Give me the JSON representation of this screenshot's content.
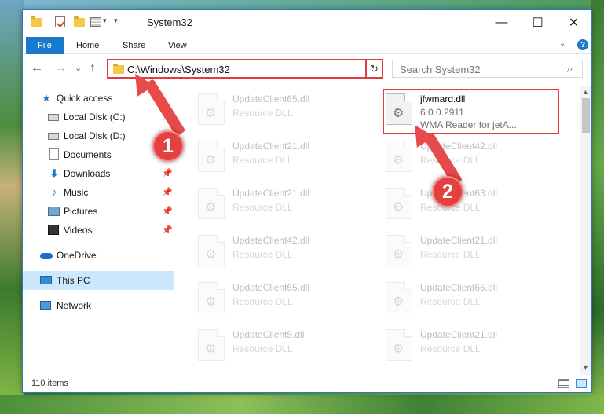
{
  "window": {
    "title": "System32",
    "controls": {
      "minimize": "—",
      "maximize": "☐",
      "close": "✕"
    }
  },
  "ribbon": {
    "tabs": [
      "File",
      "Home",
      "Share",
      "View"
    ],
    "help": "?"
  },
  "navigation": {
    "back": "←",
    "forward": "→",
    "recent": "⌄",
    "up": "↑",
    "address": "C:\\Windows\\System32",
    "search_placeholder": "Search System32"
  },
  "sidebar": {
    "items": [
      {
        "label": "Quick access",
        "icon": "star-icon"
      },
      {
        "label": "Local Disk (C:)",
        "icon": "drive-icon",
        "pinned": true
      },
      {
        "label": "Local Disk (D:)",
        "icon": "drive-icon"
      },
      {
        "label": "Documents",
        "icon": "documents-icon",
        "pinned": true
      },
      {
        "label": "Downloads",
        "icon": "downloads-icon",
        "pinned": true
      },
      {
        "label": "Music",
        "icon": "music-icon",
        "pinned": true
      },
      {
        "label": "Pictures",
        "icon": "pictures-icon",
        "pinned": true
      },
      {
        "label": "Videos",
        "icon": "videos-icon",
        "pinned": true
      },
      {
        "label": "OneDrive",
        "icon": "onedrive-icon"
      },
      {
        "label": "This PC",
        "icon": "this-pc-icon",
        "selected": true
      },
      {
        "label": "Network",
        "icon": "network-icon"
      }
    ]
  },
  "files": [
    {
      "name": "UpdateClient65.dll",
      "line1": "Resource DLL",
      "line2": ""
    },
    {
      "name": "jfwmard.dll",
      "line1": "6.0.0.2911",
      "line2": "WMA Reader for jetA..."
    },
    {
      "name": "UpdateClient21.dll",
      "line1": "Resource DLL",
      "line2": ""
    },
    {
      "name": "UpdateClient42.dll",
      "line1": "Resource DLL",
      "line2": ""
    },
    {
      "name": "UpdateClient21.dll",
      "line1": "Resource DLL",
      "line2": ""
    },
    {
      "name": "UpdateClient63.dll",
      "line1": "Resource DLL",
      "line2": ""
    },
    {
      "name": "UpdateClient42.dll",
      "line1": "Resource DLL",
      "line2": ""
    },
    {
      "name": "UpdateClient21.dll",
      "line1": "Resource DLL",
      "line2": ""
    },
    {
      "name": "UpdateClient65.dll",
      "line1": "Resource DLL",
      "line2": ""
    },
    {
      "name": "UpdateClient65.dll",
      "line1": "Resource DLL",
      "line2": ""
    },
    {
      "name": "UpdateClient5.dll",
      "line1": "Resource DLL",
      "line2": ""
    },
    {
      "name": "UpdateClient21.dll",
      "line1": "Resource DLL",
      "line2": ""
    }
  ],
  "status": {
    "item_count": "110 items"
  },
  "annotations": {
    "step1": "1",
    "step2": "2"
  },
  "colors": {
    "accent": "#1979ca",
    "highlight": "#e23c3c",
    "selection": "#cce8ff"
  }
}
